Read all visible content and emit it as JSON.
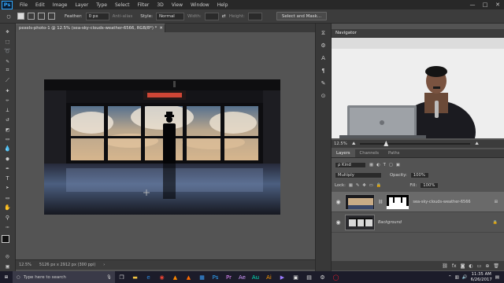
{
  "app": {
    "logo": "Ps"
  },
  "menu": [
    "File",
    "Edit",
    "Image",
    "Layer",
    "Type",
    "Select",
    "Filter",
    "3D",
    "View",
    "Window",
    "Help"
  ],
  "window_controls": [
    "—",
    "□",
    "✕"
  ],
  "options": {
    "feather_label": "Feather:",
    "feather_value": "0 px",
    "antialias_label": "Anti-alias",
    "style_label": "Style:",
    "style_value": "Normal",
    "width_label": "Width:",
    "height_label": "Height:",
    "select_mask_button": "Select and Mask..."
  },
  "document": {
    "tab_title": "pexels-photo-1 @ 12.5% (sea-sky-clouds-weather-6566, RGB/8*) *",
    "tab_close": "✕",
    "status_zoom": "12.5%",
    "status_size": "5126 px x 2912 px (300 ppi)"
  },
  "navigator": {
    "title": "Navigator",
    "zoom": "12.5%"
  },
  "layers": {
    "tabs": [
      "Layers",
      "Channels",
      "Paths"
    ],
    "kind_label": "ρ Kind",
    "blend_mode": "Multiply",
    "opacity_label": "Opacity:",
    "opacity_value": "100%",
    "lock_label": "Lock:",
    "fill_label": "Fill:",
    "fill_value": "100%",
    "items": [
      {
        "name": "sea-sky-clouds-weather-6566",
        "selected": true
      },
      {
        "name": "Background",
        "selected": false
      }
    ],
    "footer_icons": [
      "link-icon",
      "fx-icon",
      "mask-icon",
      "adjustment-icon",
      "folder-icon",
      "new-layer-icon",
      "trash-icon"
    ]
  },
  "taskbar": {
    "search_placeholder": "Type here to search",
    "time": "11:35 AM",
    "date": "6/26/2017",
    "app_labels": [
      "Ps",
      "Pr",
      "Ae",
      "Au",
      "Ai"
    ]
  },
  "colors": {
    "accent": "#31a8ff",
    "taskbar": "#1c1c2a",
    "panel": "#535353"
  }
}
